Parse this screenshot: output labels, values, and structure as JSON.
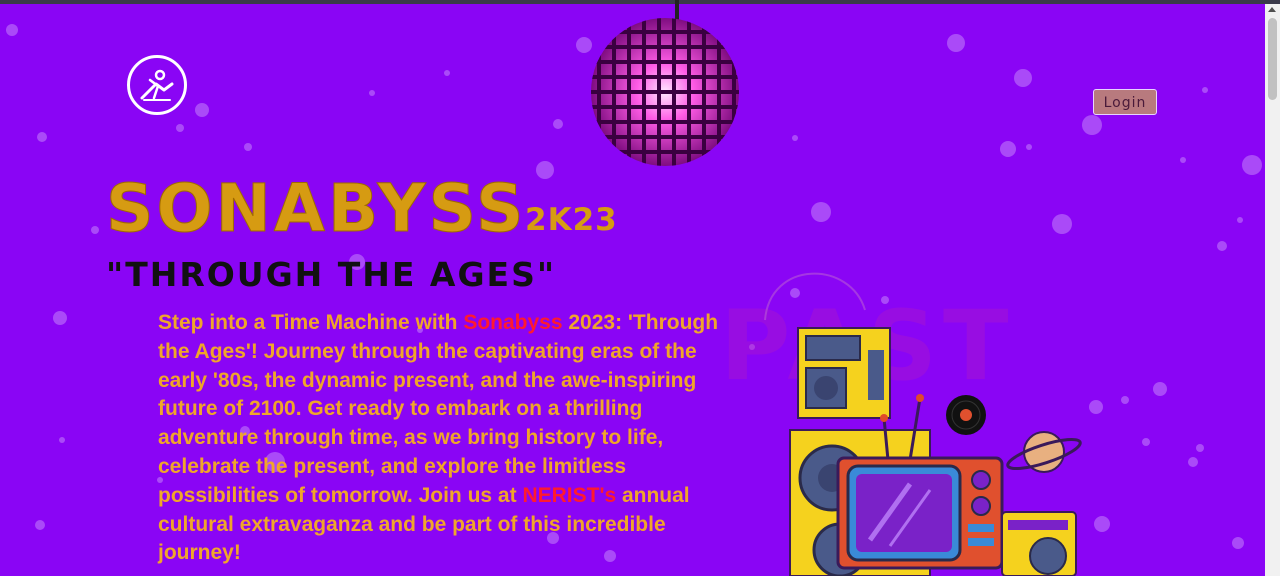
{
  "header": {
    "logo_icon": "dancer-logo-icon",
    "login_label": "Login"
  },
  "hero": {
    "title": "SONABYSS",
    "title_year": "2K23",
    "subtitle": "\"THROUGH THE AGES\"",
    "description": {
      "part1": "Step into a Time Machine with ",
      "highlight1": "Sonabyss",
      "part2": " 2023: 'Through the Ages'! Journey through the captivating eras of the early '80s, the dynamic present, and the awe-inspiring future of 2100. Get ready to embark on a thrilling adventure through time, as we bring history to life, celebrate the present, and explore the limitless possibilities of tomorrow. Join us at ",
      "highlight2": "NERIST's",
      "part3": " annual cultural extravaganza and be part of this incredible journey!"
    }
  },
  "illustration": {
    "watermark": "PAST",
    "items": [
      "disco-ball",
      "speaker",
      "retro-tv",
      "vinyl-record",
      "planet",
      "boombox"
    ]
  },
  "colors": {
    "background": "#8a05f5",
    "title": "#d69b12",
    "description": "#f0a52a",
    "highlight": "#ff1a2e",
    "login_bg": "#b87a7e"
  }
}
